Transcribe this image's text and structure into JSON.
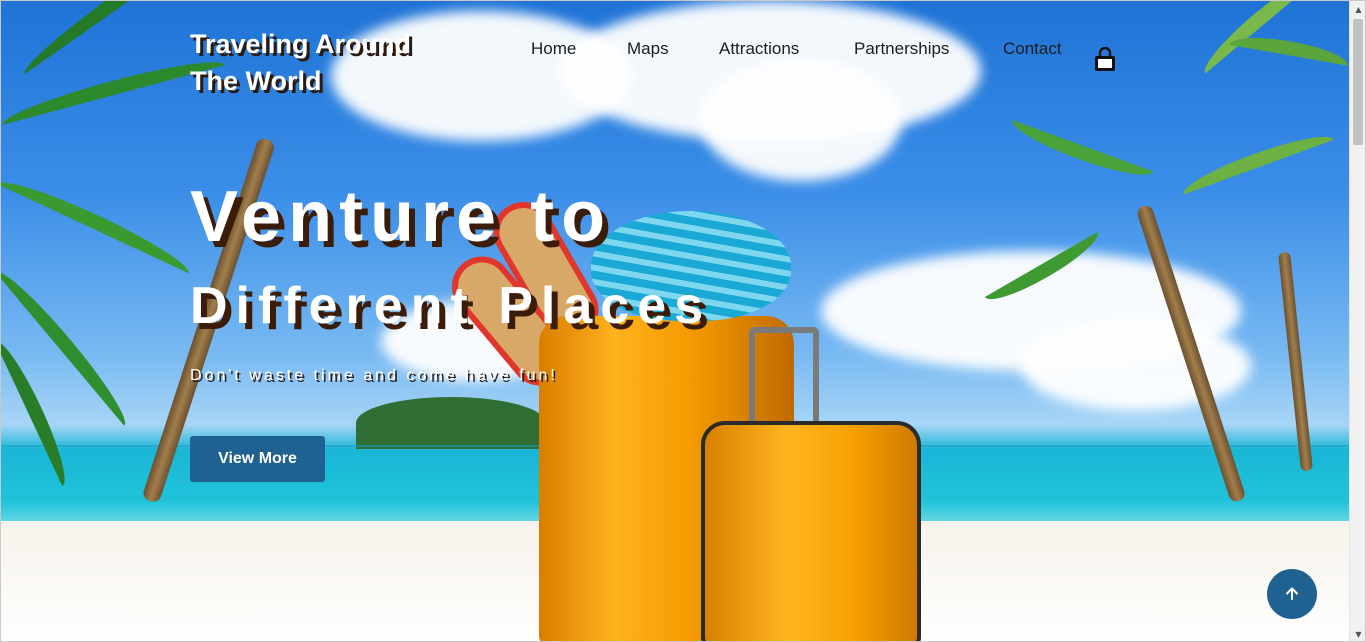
{
  "brand": {
    "line1": "Traveling Around",
    "line2": "The World"
  },
  "nav": {
    "home": "Home",
    "maps": "Maps",
    "attractions": "Attractions",
    "partnerships": "Partnerships",
    "contact": "Contact",
    "cart_icon": "shopping-bag-icon"
  },
  "hero": {
    "headline_line1": "Venture to",
    "headline_line2": "Different Places",
    "tagline": "Don't waste time and come have fun!",
    "cta_label": "View More"
  },
  "back_to_top": {
    "icon": "arrow-up-icon"
  },
  "colors": {
    "accent": "#1f6191",
    "text_shadow": "#3a1c09",
    "nav_text": "#1d1d1d"
  }
}
